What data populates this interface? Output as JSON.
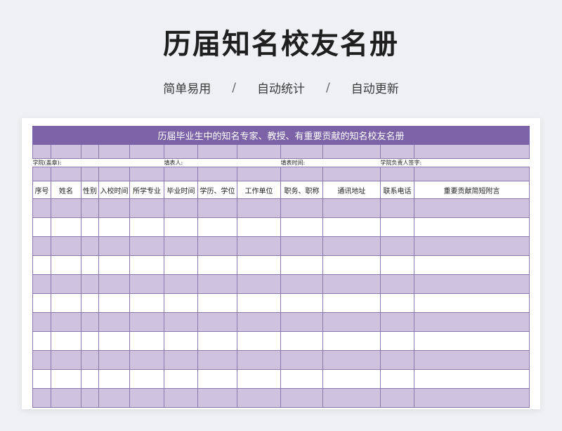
{
  "page": {
    "title": "历届知名校友名册",
    "features": [
      "简单易用",
      "自动统计",
      "自动更新"
    ],
    "separator": "/"
  },
  "sheet": {
    "banner": "历届毕业生中的知名专家、教授、有重要贡献的知名校友名册",
    "info": {
      "college": "学院(盖章):",
      "filler": "填表人:",
      "fill_time": "填表时间:",
      "signature": "学院负责人签字:"
    },
    "columns": [
      "序号",
      "姓名",
      "性别",
      "入校时间",
      "所学专业",
      "毕业时间",
      "学历、学位",
      "工作单位",
      "职务、职称",
      "通讯地址",
      "联系电话",
      "重要贡献简短附言"
    ],
    "data_row_count": 11
  },
  "colors": {
    "banner": "#7c62a6",
    "row_purple": "#cfc2de",
    "row_white": "#ffffff",
    "grid": "#8c78ad"
  }
}
